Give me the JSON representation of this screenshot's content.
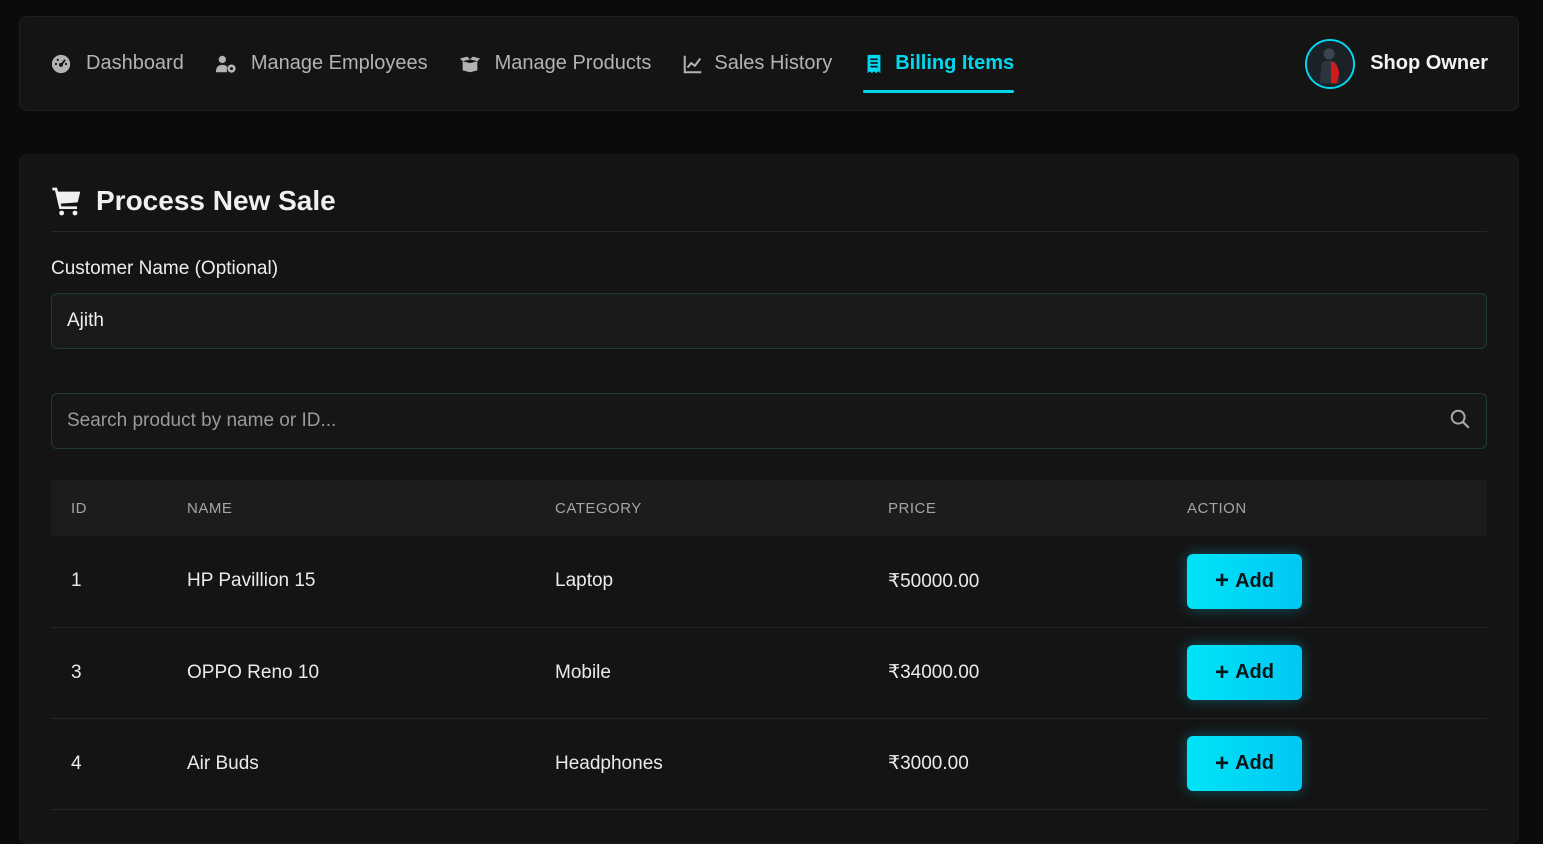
{
  "nav": {
    "items": [
      {
        "label": "Dashboard",
        "icon": "gauge-icon",
        "active": false
      },
      {
        "label": "Manage Employees",
        "icon": "users-cog-icon",
        "active": false
      },
      {
        "label": "Manage Products",
        "icon": "box-open-icon",
        "active": false
      },
      {
        "label": "Sales History",
        "icon": "line-chart-icon",
        "active": false
      },
      {
        "label": "Billing Items",
        "icon": "receipt-icon",
        "active": true
      }
    ],
    "user_name": "Shop Owner"
  },
  "colors": {
    "accent": "#00d8f0",
    "background": "#0b0b0b",
    "card": "#141414"
  },
  "sale": {
    "title": "Process New Sale",
    "customer_label": "Customer Name (Optional)",
    "customer_value": "Ajith",
    "search_placeholder": "Search product by name or ID..."
  },
  "table": {
    "headers": [
      "ID",
      "NAME",
      "CATEGORY",
      "PRICE",
      "ACTION"
    ],
    "rows": [
      {
        "id": "1",
        "name": "HP Pavillion 15",
        "category": "Laptop",
        "price": "₹50000.00",
        "action": "Add"
      },
      {
        "id": "3",
        "name": "OPPO Reno 10",
        "category": "Mobile",
        "price": "₹34000.00",
        "action": "Add"
      },
      {
        "id": "4",
        "name": "Air Buds",
        "category": "Headphones",
        "price": "₹3000.00",
        "action": "Add"
      }
    ]
  }
}
